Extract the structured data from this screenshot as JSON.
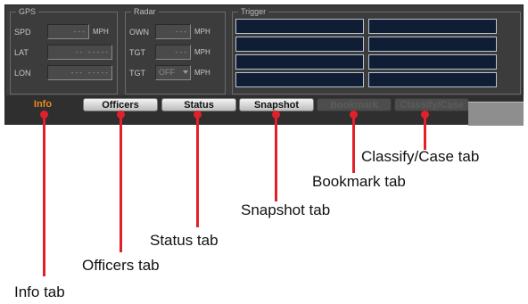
{
  "gps": {
    "title": "GPS",
    "spd_label": "SPD",
    "spd_value": "---",
    "spd_unit": "MPH",
    "lat_label": "LAT",
    "lat_value": "-- -----",
    "lon_label": "LON",
    "lon_value": "--- -----"
  },
  "radar": {
    "title": "Radar",
    "own_label": "OWN",
    "own_value": "---",
    "own_unit": "MPH",
    "tgt1_label": "TGT",
    "tgt1_value": "---",
    "tgt1_unit": "MPH",
    "tgt2_label": "TGT",
    "tgt2_value": "OFF",
    "tgt2_unit": "MPH"
  },
  "trigger": {
    "title": "Trigger"
  },
  "tabs": [
    {
      "label": "Info",
      "state": "active"
    },
    {
      "label": "Officers",
      "state": "normal"
    },
    {
      "label": "Status",
      "state": "normal"
    },
    {
      "label": "Snapshot",
      "state": "normal"
    },
    {
      "label": "Bookmark",
      "state": "disabled"
    },
    {
      "label": "Classify/Case",
      "state": "disabled"
    }
  ],
  "callouts": {
    "info": "Info tab",
    "officers": "Officers tab",
    "status": "Status tab",
    "snapshot": "Snapshot tab",
    "bookmark": "Bookmark tab",
    "classify": "Classify/Case tab"
  },
  "colors": {
    "panel": "#3c3c3c",
    "active_tab": "#e8891e",
    "callout_red": "#e1202a",
    "trigger_slot": "#0f1e34"
  }
}
